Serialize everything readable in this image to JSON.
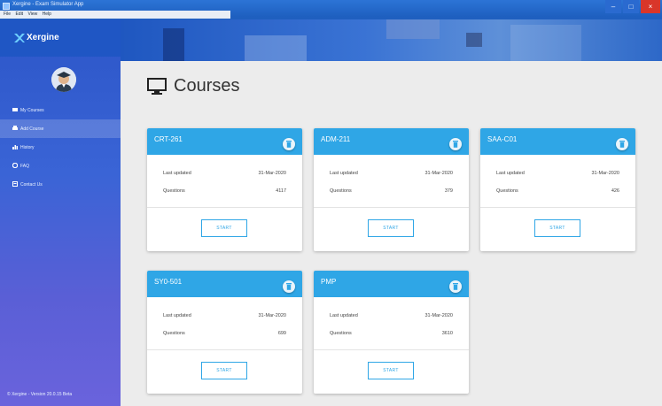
{
  "window": {
    "title": "Xergine - Exam Simulator App"
  },
  "menu": [
    "File",
    "Edit",
    "View",
    "Help"
  ],
  "brand": {
    "name": "Xergine"
  },
  "sidebar": {
    "items": [
      {
        "label": "My Courses",
        "icon": "book-icon"
      },
      {
        "label": "Add Course",
        "icon": "add-icon"
      },
      {
        "label": "History",
        "icon": "chart-icon"
      },
      {
        "label": "FAQ",
        "icon": "help-icon"
      },
      {
        "label": "Contact Us",
        "icon": "contact-icon"
      }
    ],
    "version": "© Xergine - Version 20.0.15 Beta"
  },
  "page": {
    "title": "Courses"
  },
  "labels": {
    "last_updated": "Last updated",
    "questions": "Questions",
    "start": "START"
  },
  "courses": [
    {
      "code": "CRT-261",
      "last_updated": "31-Mar-2020",
      "questions": "4117"
    },
    {
      "code": "ADM-211",
      "last_updated": "31-Mar-2020",
      "questions": "379"
    },
    {
      "code": "SAA-C01",
      "last_updated": "31-Mar-2020",
      "questions": "426"
    },
    {
      "code": "SY0-501",
      "last_updated": "31-Mar-2020",
      "questions": "699"
    },
    {
      "code": "PMP",
      "last_updated": "31-Mar-2020",
      "questions": "3610"
    }
  ],
  "colors": {
    "card_header": "#2fa6e6",
    "sidebar": "#3a64d6",
    "close": "#d9362a"
  }
}
